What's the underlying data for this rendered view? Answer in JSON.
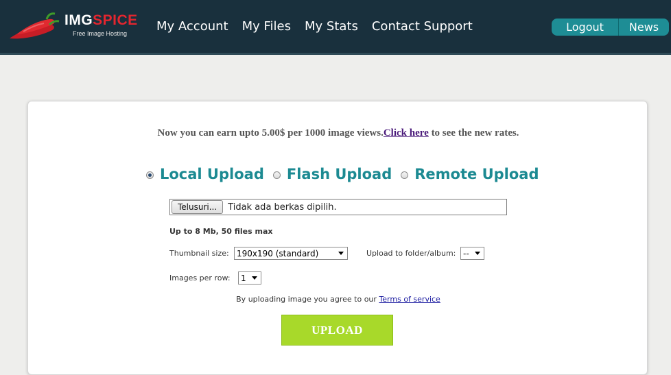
{
  "header": {
    "brand_part1": "IMG",
    "brand_part2": "SPICE",
    "tagline": "Free Image Hosting",
    "nav": [
      "My Account",
      "My Files",
      "My Stats",
      "Contact Support"
    ],
    "logout": "Logout",
    "news": "News"
  },
  "promo": {
    "text_before": "Now you can earn upto 5.00$ per 1000 image views.",
    "link": "Click here",
    "text_after": " to see the new rates."
  },
  "upload_modes": [
    {
      "label": "Local Upload",
      "selected": true
    },
    {
      "label": "Flash Upload",
      "selected": false
    },
    {
      "label": "Remote Upload",
      "selected": false
    }
  ],
  "file_input": {
    "button": "Telusuri...",
    "status": "Tidak ada berkas dipilih."
  },
  "limit_text": "Up to 8 Mb, 50 files max",
  "thumbnail": {
    "label": "Thumbnail size:",
    "value": "190x190 (standard)"
  },
  "folder": {
    "label": "Upload to folder/album:",
    "value": "--"
  },
  "per_row": {
    "label": "Images per row:",
    "value": "1"
  },
  "terms": {
    "text": "By uploading image you agree to our ",
    "link": "Terms of service"
  },
  "upload_button": "UPLOAD",
  "colors": {
    "header_bg": "#19303d",
    "accent_teal": "#1c8a92",
    "brand_red": "#e3262f",
    "upload_green": "#a8d92a"
  },
  "icons": [
    "chili-pepper-logo-icon"
  ]
}
